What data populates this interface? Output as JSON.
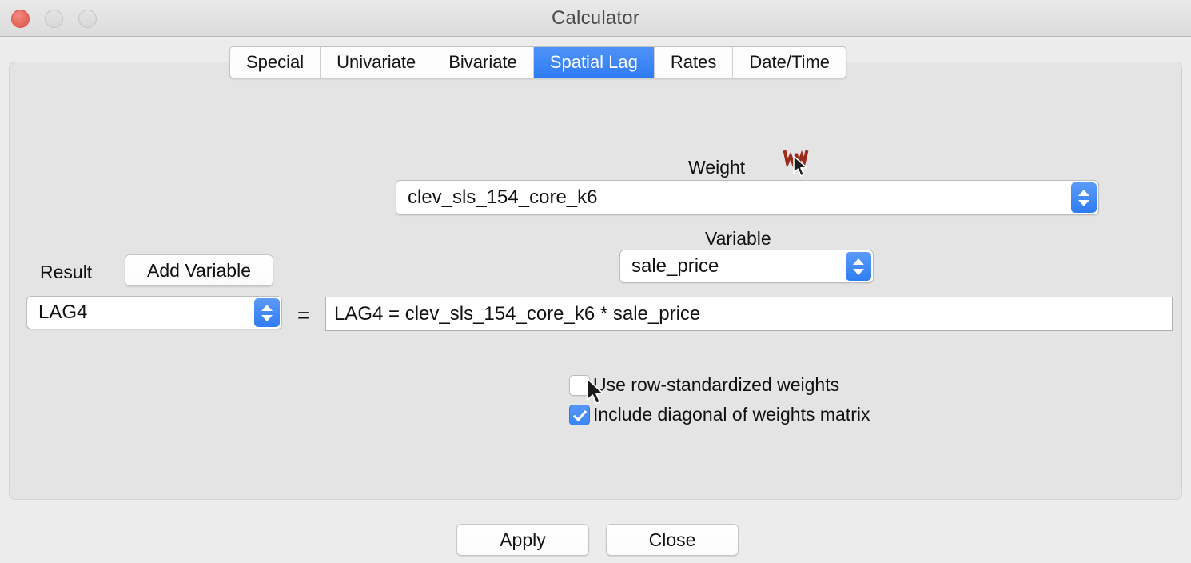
{
  "window": {
    "title": "Calculator",
    "traffic_lights": [
      "close",
      "minimize",
      "maximize"
    ],
    "accent_blue": "#2f7cf4",
    "close_red": "#e8685e",
    "panel_bg": "#e4e4e4",
    "window_bg": "#ececec"
  },
  "tabs": [
    {
      "label": "Special",
      "active": false
    },
    {
      "label": "Univariate",
      "active": false
    },
    {
      "label": "Bivariate",
      "active": false
    },
    {
      "label": "Spatial Lag",
      "active": true
    },
    {
      "label": "Rates",
      "active": false
    },
    {
      "label": "Date/Time",
      "active": false
    }
  ],
  "form": {
    "weight_label": "Weight",
    "weight_icon": "weights-w-icon",
    "weight_value": "clev_sls_154_core_k6",
    "variable_label": "Variable",
    "variable_value": "sale_price",
    "result_label": "Result",
    "add_variable_label": "Add Variable",
    "result_value": "LAG4",
    "equals_sign": "=",
    "expression": "LAG4 = clev_sls_154_core_k6 * sale_price"
  },
  "options": [
    {
      "label": "Use row-standardized weights",
      "checked": false
    },
    {
      "label": "Include diagonal of weights matrix",
      "checked": true
    }
  ],
  "footer": {
    "apply_label": "Apply",
    "close_label": "Close"
  }
}
